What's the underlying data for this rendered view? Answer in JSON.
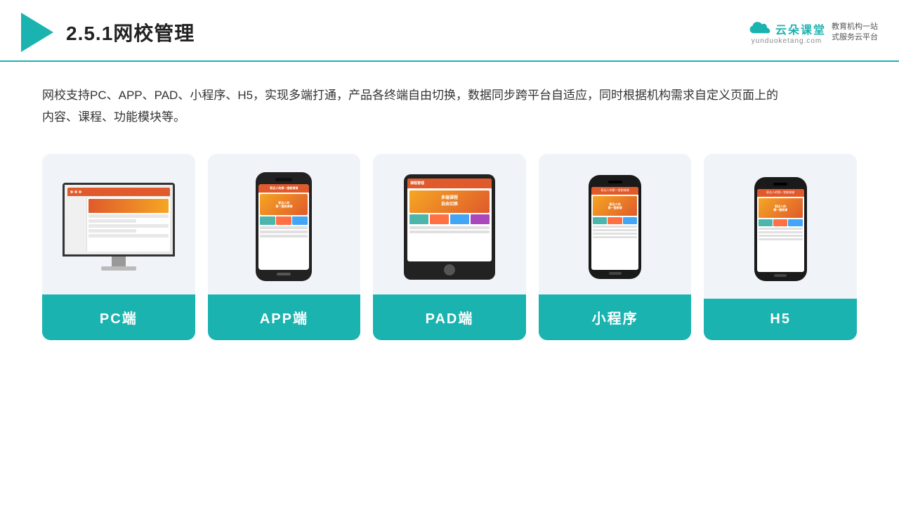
{
  "header": {
    "title": "2.5.1网校管理",
    "brand": {
      "name": "云朵课堂",
      "url": "yunduoketang.com",
      "tagline": "教育机构一站\n式服务云平台"
    }
  },
  "description": "网校支持PC、APP、PAD、小程序、H5，实现多端打通，产品各终端自由切换，数据同步跨平台自适应，同时根据机构需求自定义页面上的内容、课程、功能模块等。",
  "cards": [
    {
      "id": "pc",
      "label": "PC端"
    },
    {
      "id": "app",
      "label": "APP端"
    },
    {
      "id": "pad",
      "label": "PAD端"
    },
    {
      "id": "miniapp",
      "label": "小程序"
    },
    {
      "id": "h5",
      "label": "H5"
    }
  ],
  "colors": {
    "teal": "#1ab3b0",
    "accent": "#e05a2b"
  }
}
